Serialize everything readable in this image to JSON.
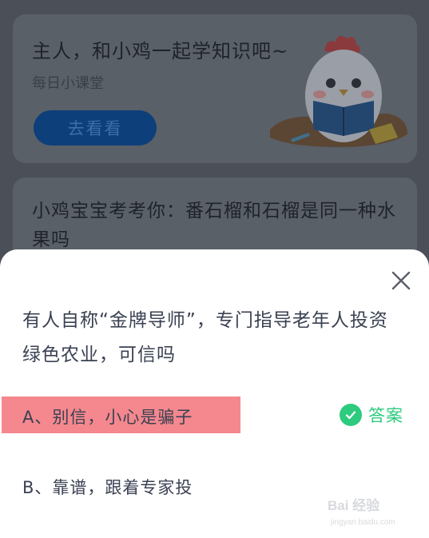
{
  "lesson_card": {
    "title": "主人，和小鸡一起学知识吧~",
    "subtitle": "每日小课堂",
    "button_label": "去看看",
    "illustration": "chick-reading-book-icon"
  },
  "quiz_card": {
    "question": "小鸡宝宝考考你：番石榴和石榴是同一种水果吗"
  },
  "sheet": {
    "question": "有人自称“金牌导师”，专门指导老年人投资绿色农业，可信吗",
    "close_icon": "close-icon",
    "options": [
      {
        "label": "A、别信，小心是骗子",
        "highlighted": true
      },
      {
        "label": "B、靠谱，跟着专家投",
        "highlighted": false
      }
    ],
    "answer_label": "答案",
    "answer_icon": "check-circle-icon",
    "answer_color": "#2ecb7f",
    "highlight_color": "#f4888e"
  },
  "watermark": {
    "brand": "Bai 经验",
    "url": "jingyan.baidu.com"
  }
}
